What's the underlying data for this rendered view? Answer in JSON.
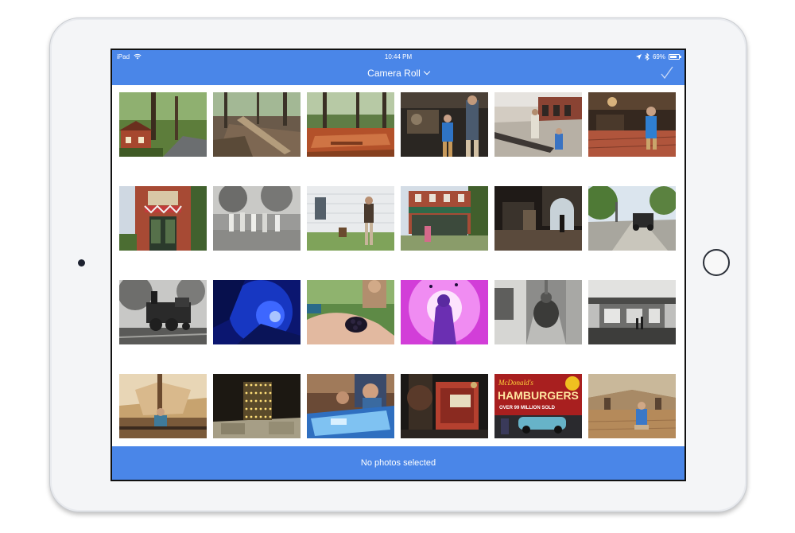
{
  "status_bar": {
    "carrier": "iPad",
    "time": "10:44 PM",
    "battery": "69%",
    "battery_level": 0.69
  },
  "nav": {
    "title": "Camera Roll",
    "confirm_icon": "checkmark-icon"
  },
  "photos": [
    {
      "id": "forest-cabin"
    },
    {
      "id": "fallen-tree"
    },
    {
      "id": "forest-floor"
    },
    {
      "id": "workshop-man"
    },
    {
      "id": "roundhouse"
    },
    {
      "id": "brick-workshop"
    },
    {
      "id": "red-brick-tower"
    },
    {
      "id": "bw-gathering"
    },
    {
      "id": "white-house"
    },
    {
      "id": "general-store"
    },
    {
      "id": "engine-room"
    },
    {
      "id": "vintage-car"
    },
    {
      "id": "bw-locomotive"
    },
    {
      "id": "blue-glow"
    },
    {
      "id": "hand-blackberry"
    },
    {
      "id": "pink-silhouette"
    },
    {
      "id": "bw-sculpture"
    },
    {
      "id": "bw-gallery"
    },
    {
      "id": "museum-atrium"
    },
    {
      "id": "led-cube"
    },
    {
      "id": "touch-table"
    },
    {
      "id": "red-machine"
    },
    {
      "id": "hamburgers-sign"
    },
    {
      "id": "museum-hall"
    }
  ],
  "hamburgers_sign": {
    "brand": "McDonald's",
    "main": "HAMBURGERS",
    "sub": "OVER 99 MILLION SOLD"
  },
  "bottom_bar": {
    "status": "No photos selected"
  }
}
